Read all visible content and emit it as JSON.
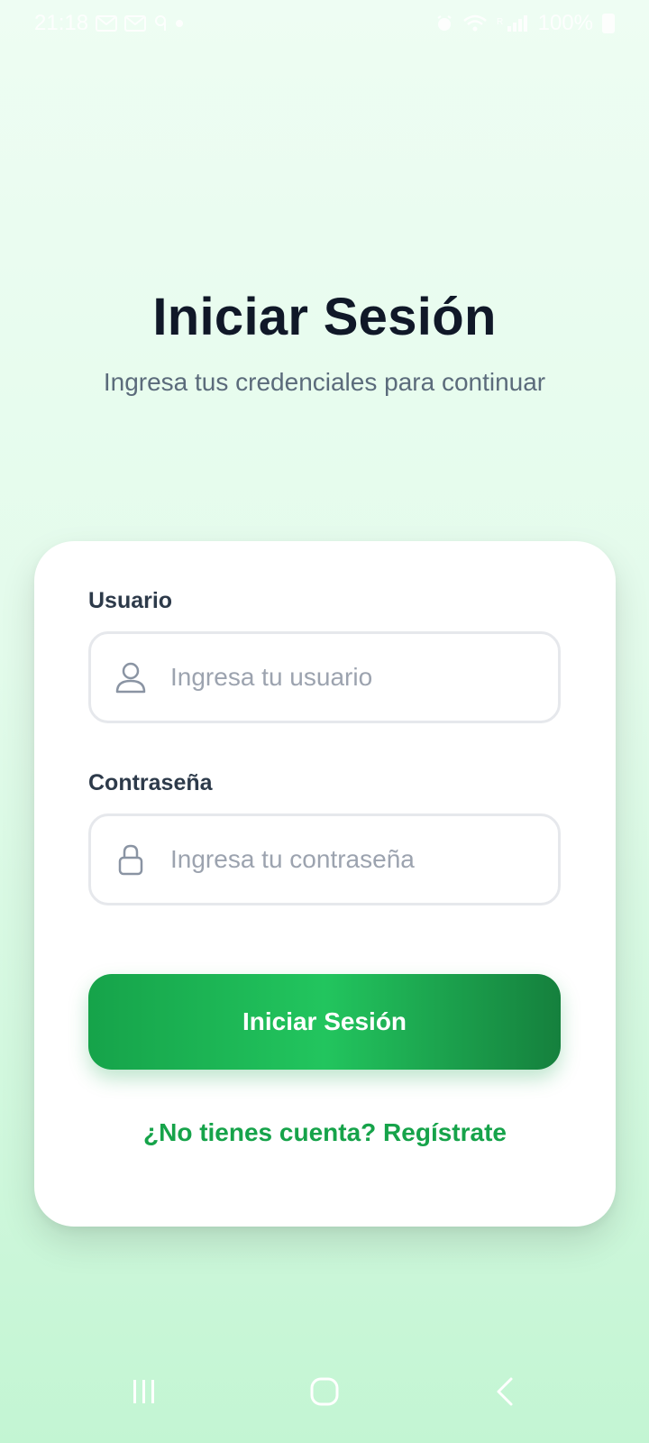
{
  "status_bar": {
    "time": "21:18",
    "battery": "100%",
    "icons": [
      "gmail-icon",
      "gmail-icon",
      "ninegag-icon",
      "dot-icon",
      "alarm-icon",
      "wifi-icon",
      "signal-icon",
      "battery-icon"
    ]
  },
  "header": {
    "title": "Iniciar Sesión",
    "subtitle": "Ingresa tus credenciales para continuar"
  },
  "form": {
    "username": {
      "label": "Usuario",
      "placeholder": "Ingresa tu usuario",
      "value": ""
    },
    "password": {
      "label": "Contraseña",
      "placeholder": "Ingresa tu contraseña",
      "value": ""
    },
    "submit_label": "Iniciar Sesión",
    "register_link": "¿No tienes cuenta? Regístrate"
  },
  "colors": {
    "accent": "#16a34a",
    "title": "#101828",
    "subtitle": "#5b6b7b"
  },
  "nav_bar": {
    "buttons": [
      "recent-apps-icon",
      "home-icon",
      "back-icon"
    ]
  }
}
